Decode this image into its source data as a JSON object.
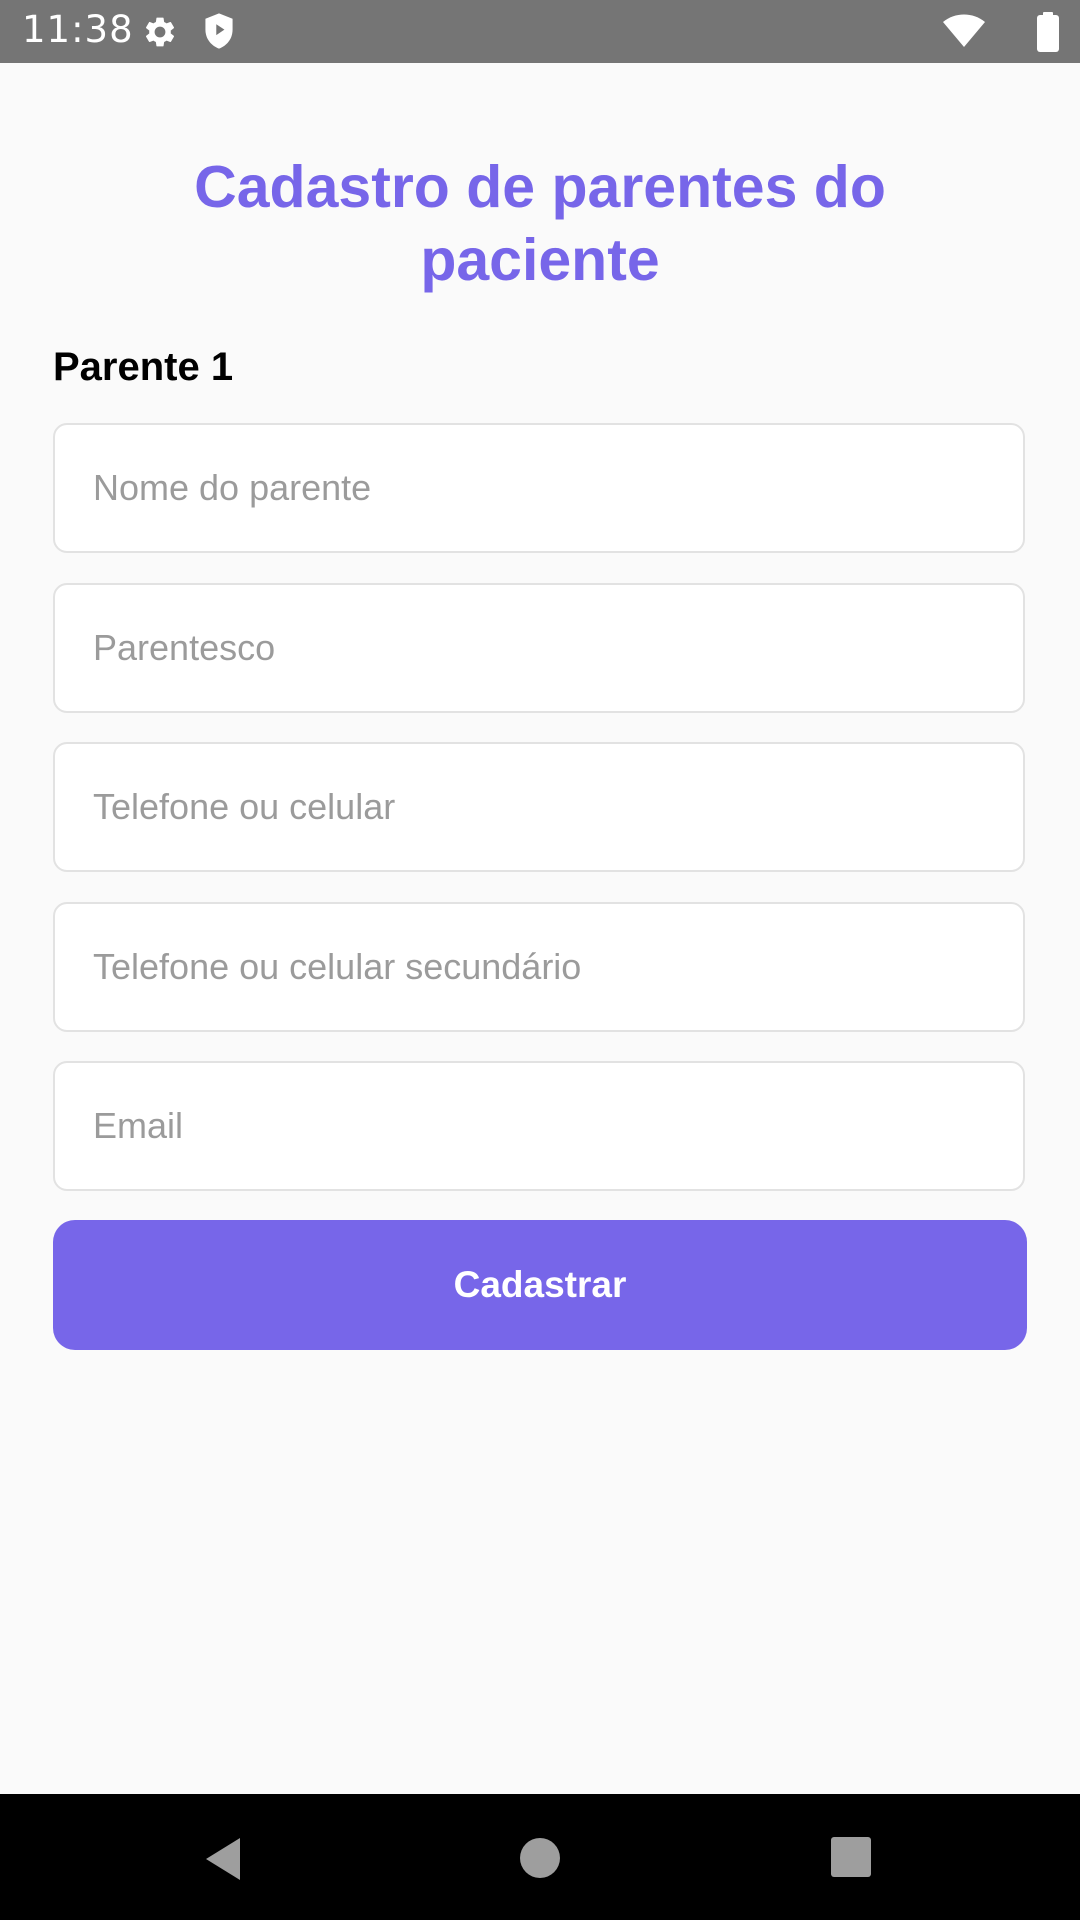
{
  "status_bar": {
    "time": "11:38",
    "icons": [
      "gear-icon",
      "shield-icon",
      "wifi-icon",
      "battery-icon"
    ]
  },
  "page": {
    "title": "Cadastro de parentes do paciente",
    "section_label": "Parente 1"
  },
  "form": {
    "name_placeholder": "Nome do parente",
    "relationship_placeholder": "Parentesco",
    "phone_placeholder": "Telefone ou celular",
    "phone2_placeholder": "Telefone ou celular secundário",
    "email_placeholder": "Email",
    "name_value": "",
    "relationship_value": "",
    "phone_value": "",
    "phone2_value": "",
    "email_value": "",
    "submit_label": "Cadastrar"
  },
  "nav_bar": {
    "icons": [
      "back-icon",
      "home-icon",
      "recents-icon"
    ]
  },
  "colors": {
    "accent": "#7766e9",
    "status_bar": "#757575",
    "background": "#fafafa",
    "nav_bar": "#000000"
  }
}
